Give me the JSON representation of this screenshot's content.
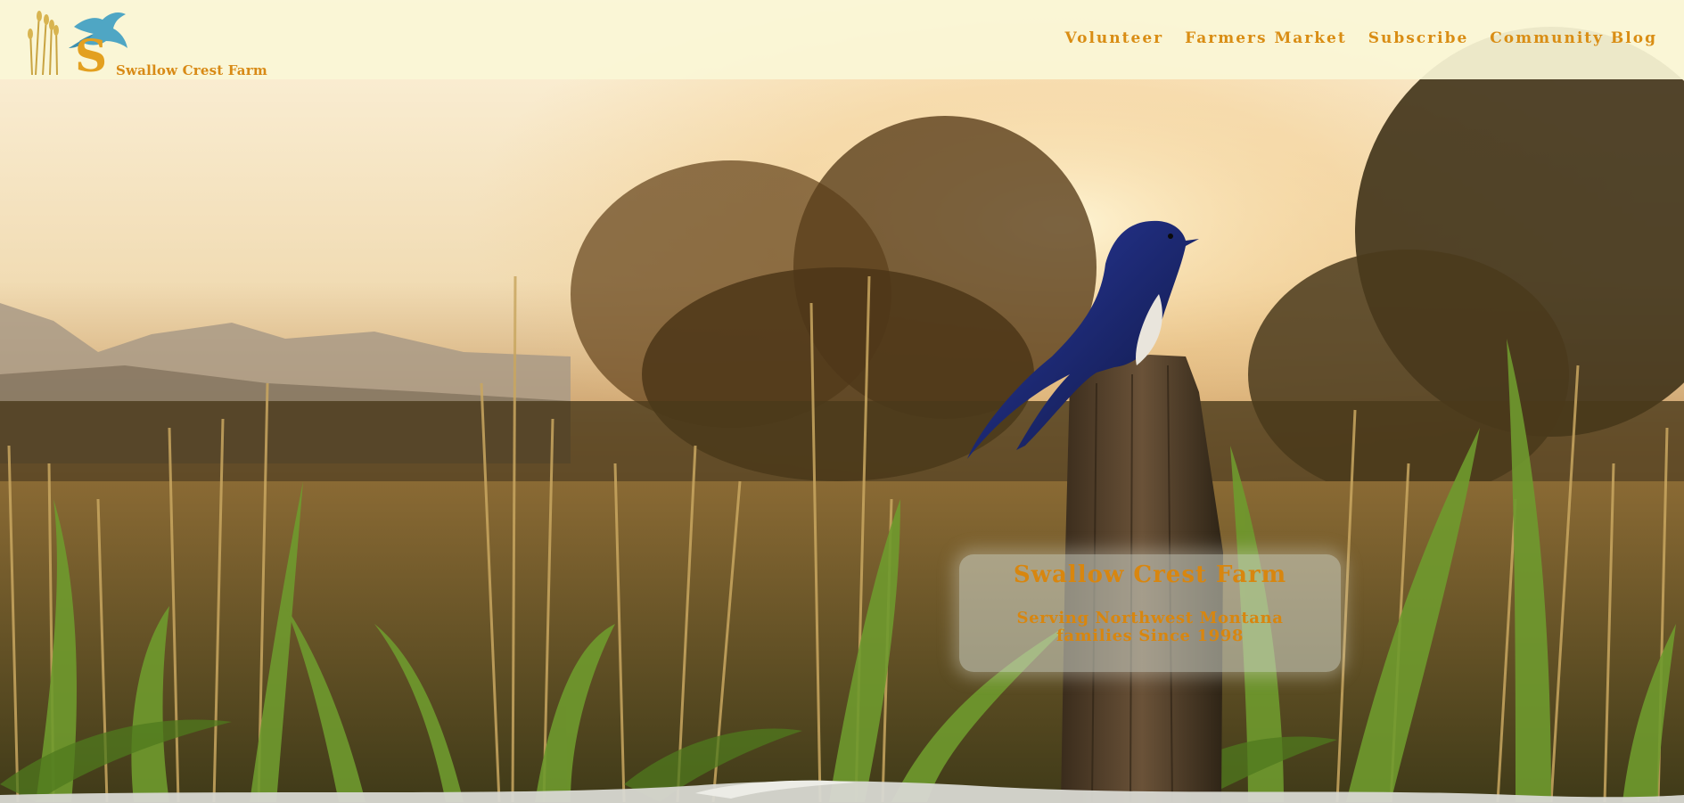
{
  "brand": {
    "name": "Swallow Crest Farm",
    "logo_icons": [
      "wheat-icon",
      "swallow-bird-icon"
    ],
    "accent_color": "#d98d14"
  },
  "nav": {
    "items": [
      {
        "label": "Volunteer"
      },
      {
        "label": "Farmers Market"
      },
      {
        "label": "Subscribe"
      },
      {
        "label": "Community Blog"
      }
    ]
  },
  "hero": {
    "image": "swallow-on-fence-post-in-cornfield-at-sunset",
    "title": "Swallow Crest Farm",
    "subtitle": "Serving Northwest Montana families Since 1998"
  }
}
